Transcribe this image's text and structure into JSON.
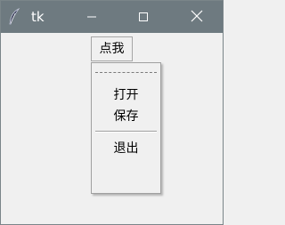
{
  "window": {
    "title": "tk",
    "app_icon": "feather-icon",
    "controls": {
      "minimize_icon": "minimize-icon",
      "maximize_icon": "maximize-icon",
      "close_icon": "close-icon"
    },
    "titlebar_color": "#6e7a80"
  },
  "menubutton": {
    "label": "点我"
  },
  "menu": {
    "tearoff": true,
    "items": [
      {
        "label": "打开"
      },
      {
        "label": "保存"
      },
      {
        "label": "退出"
      }
    ]
  }
}
